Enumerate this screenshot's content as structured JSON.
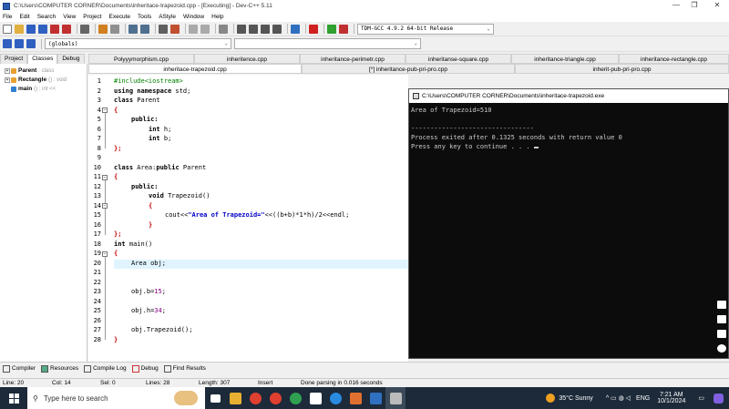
{
  "window": {
    "title": "C:\\Users\\COMPUTER CORNER\\Documents\\inheritace-trapezoid.cpp - [Executing] - Dev-C++ 5.11",
    "controls": [
      "—",
      "❐",
      "✕"
    ]
  },
  "menu": [
    "File",
    "Edit",
    "Search",
    "View",
    "Project",
    "Execute",
    "Tools",
    "AStyle",
    "Window",
    "Help"
  ],
  "toolbar": {
    "compiler": "TDM-GCC 4.9.2 64-bit Release",
    "scope": "(globals)"
  },
  "left_tabs": [
    "Project",
    "Classes",
    "Debug"
  ],
  "class_tree": [
    {
      "name": "Parent",
      "note": ": class",
      "expand": "+"
    },
    {
      "name": "Rectangle",
      "note": "() : void",
      "expand": "+"
    },
    {
      "name": "main",
      "note": "() : int <<",
      "expand": ""
    }
  ],
  "editor_tabs_row1": [
    "Polyyymorphism.cpp",
    "inheritence.cpp",
    "inheritance-perimetr.cpp",
    "inheritanse-square.cpp",
    "inheritance-triangle.cpp",
    "inheritance-rectangle.cpp"
  ],
  "editor_tabs_row2": [
    "inheritace-trapezoid.cpp",
    "[*] inheritance-pub-pri-pro.cpp",
    "inherit-pub-pri-pro.cpp"
  ],
  "code": {
    "line_numbers": [
      "1",
      "2",
      "3",
      "4",
      "5",
      "6",
      "7",
      "8",
      "9",
      "10",
      "11",
      "12",
      "13",
      "14",
      "15",
      "16",
      "17",
      "18",
      "19",
      "20",
      "21",
      "22",
      "23",
      "24",
      "25",
      "26",
      "27",
      "28"
    ],
    "l1": "#include<iostream>",
    "l2_kw": "using namespace",
    "l2_rest": " std;",
    "l3_kw": "class",
    "l3_rest": " Parent",
    "l4": "{",
    "l5": "public:",
    "l6_kw": "int",
    "l6_rest": " h;",
    "l7_kw": "int",
    "l7_rest": " b;",
    "l8": "};",
    "l10_kw": "class",
    "l10_mid": " Area:",
    "l10_kw2": "public",
    "l10_rest": " Parent",
    "l11": "{",
    "l12": "public:",
    "l13_kw": "void",
    "l13_rest": " Trapezoid()",
    "l14": "{",
    "l15_a": "cout<<",
    "l15_str": "\"Area of Trapezoid=\"",
    "l15_b": "<<((b+b)*1*h)/2<<endl;",
    "l16": "}",
    "l17": "};",
    "l18_kw": "int",
    "l18_rest": " main()",
    "l19": "{",
    "l20": "Area obj;",
    "l23_a": "obj.b=",
    "l23_num": "15",
    "l23_b": ";",
    "l25_a": "obj.h=",
    "l25_num": "34",
    "l25_b": ";",
    "l27": "obj.Trapezoid();",
    "l28": "}"
  },
  "console": {
    "title": "C:\\Users\\COMPUTER CORNER\\Documents\\inheritace-trapezoid.exe",
    "line1": "Area of Trapezoid=510",
    "line2": "--------------------------------",
    "line3": "Process exited after 0.1325 seconds with return value 0",
    "line4": "Press any key to continue . . . "
  },
  "bottom_tabs": [
    "Compiler",
    "Resources",
    "Compile Log",
    "Debug",
    "Find Results"
  ],
  "status": {
    "line": "Line:   20",
    "col": "Col:   14",
    "sel": "Sel:   0",
    "lines": "Lines:   28",
    "length": "Length:   307",
    "mode": "Insert",
    "message": "Done parsing in 0.016 seconds"
  },
  "taskbar": {
    "search_placeholder": "Type here to search",
    "weather": "35°C  Sunny",
    "lang": "ENG",
    "time": "7:21 AM",
    "date": "10/1/2024"
  },
  "colors": {
    "keyword": "#000000",
    "preprocessor": "#008000",
    "brace": "#c00000",
    "string": "#0000c8",
    "number": "#800080",
    "highlight_line": "#dff4ff",
    "console_bg": "#0c0c0c",
    "taskbar_bg": "#1c2a3a"
  }
}
